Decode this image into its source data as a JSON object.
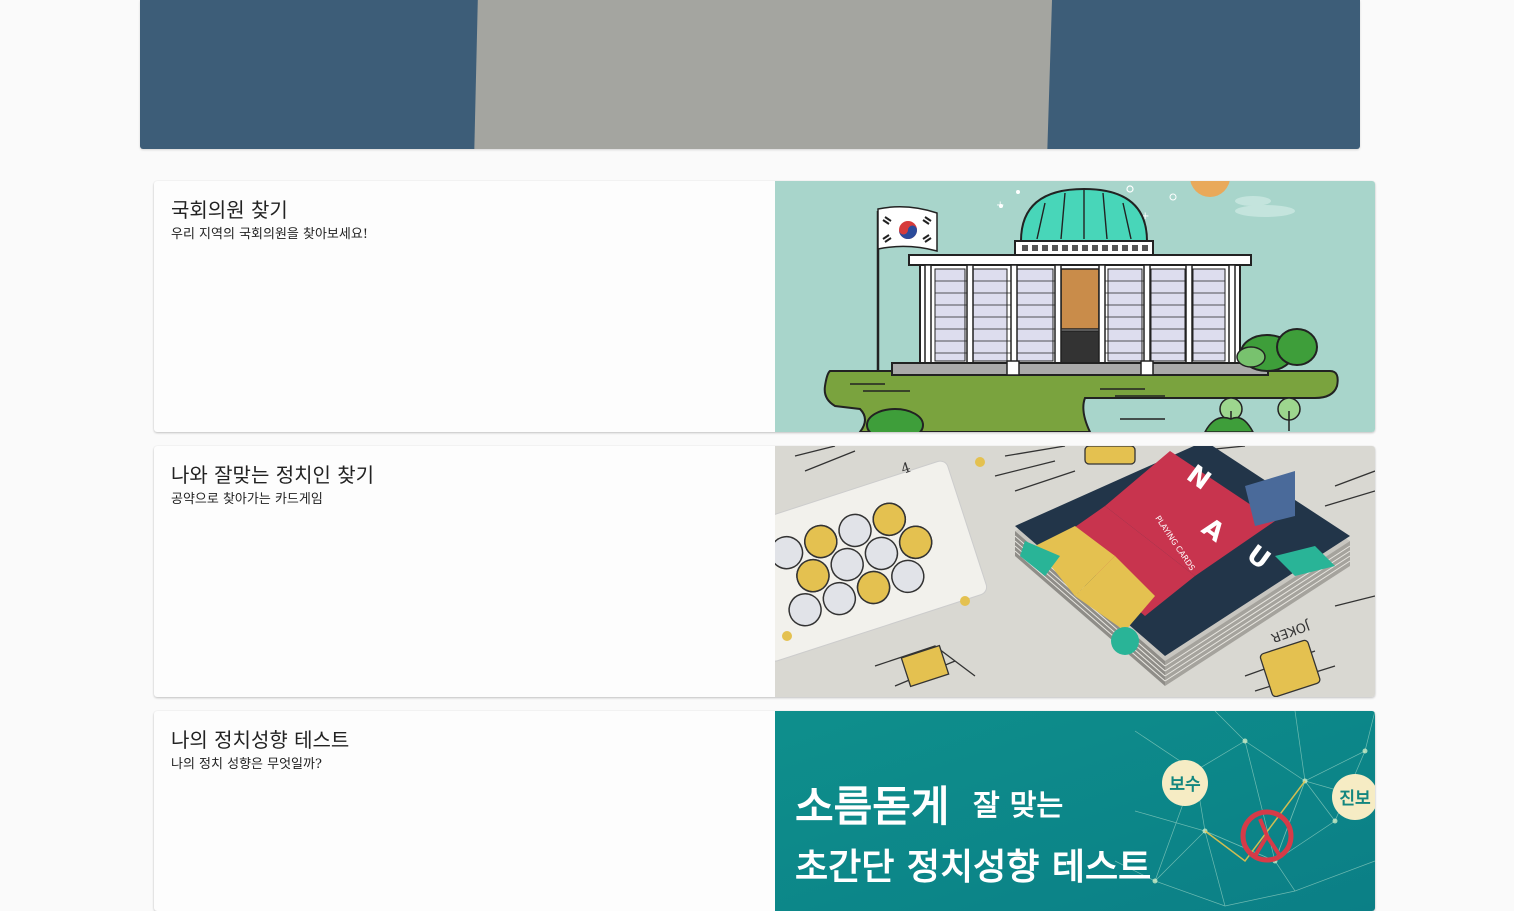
{
  "cards": [
    {
      "title": "국회의원 찾기",
      "subtitle": "우리 지역의 국회의원을 찾아보세요!"
    },
    {
      "title": "나와 잘맞는 정치인 찾기",
      "subtitle": "공약으로 찾아가는 카드게임",
      "image_text": {
        "deck_letters": [
          "N",
          "A",
          "U"
        ],
        "deck_caption": "PLAYING CARDS",
        "joker": "JOKER"
      }
    },
    {
      "title": "나의 정치성향 테스트",
      "subtitle": "나의 정치 성향은 무엇일까?",
      "image_text": {
        "line1_big": "소름돋게",
        "line1_small": "잘 맞는",
        "line2": "초간단 정치성향 테스트",
        "badge_left": "보수",
        "badge_right": "진보"
      }
    }
  ],
  "colors": {
    "hero_bg": "#3d5d78",
    "hero_panel": "#a4a5a0",
    "card1_bg": "#a8d5cb",
    "card3_bg": "#0e8f8c"
  }
}
